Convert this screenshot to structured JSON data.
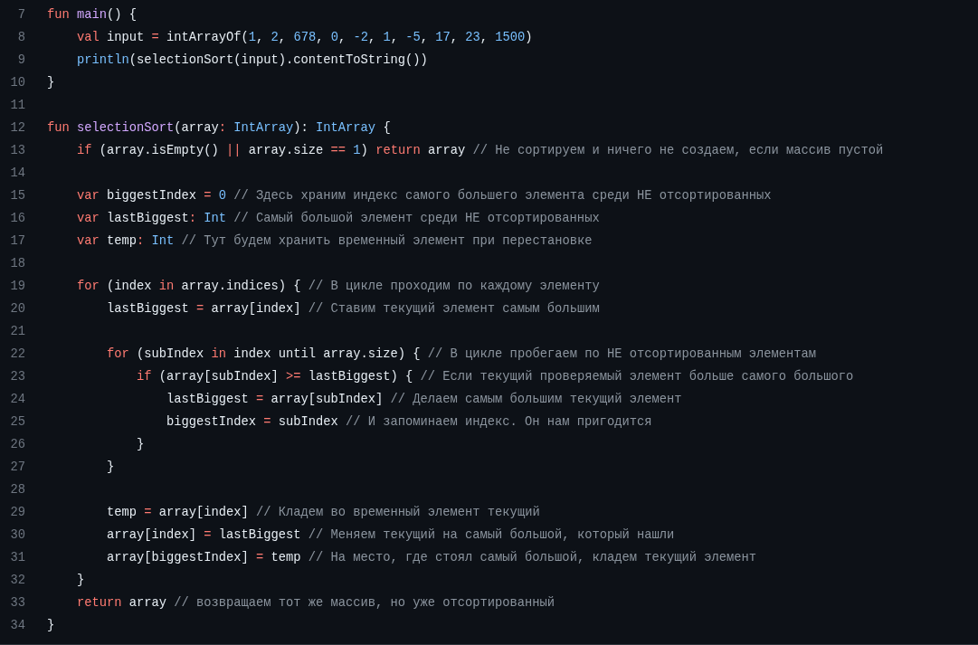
{
  "code_lines": [
    {
      "number": "7",
      "tokens": [
        {
          "kind": "kw",
          "text": "fun "
        },
        {
          "kind": "fn",
          "text": "main"
        },
        {
          "kind": "plain",
          "text": "() {"
        }
      ]
    },
    {
      "number": "8",
      "tokens": [
        {
          "kind": "kw",
          "text": "    val "
        },
        {
          "kind": "plain",
          "text": "input "
        },
        {
          "kind": "op",
          "text": "= "
        },
        {
          "kind": "plain",
          "text": "intArrayOf("
        },
        {
          "kind": "num",
          "text": "1"
        },
        {
          "kind": "plain",
          "text": ", "
        },
        {
          "kind": "num",
          "text": "2"
        },
        {
          "kind": "plain",
          "text": ", "
        },
        {
          "kind": "num",
          "text": "678"
        },
        {
          "kind": "plain",
          "text": ", "
        },
        {
          "kind": "num",
          "text": "0"
        },
        {
          "kind": "plain",
          "text": ", "
        },
        {
          "kind": "num",
          "text": "-2"
        },
        {
          "kind": "plain",
          "text": ", "
        },
        {
          "kind": "num",
          "text": "1"
        },
        {
          "kind": "plain",
          "text": ", "
        },
        {
          "kind": "num",
          "text": "-5"
        },
        {
          "kind": "plain",
          "text": ", "
        },
        {
          "kind": "num",
          "text": "17"
        },
        {
          "kind": "plain",
          "text": ", "
        },
        {
          "kind": "num",
          "text": "23"
        },
        {
          "kind": "plain",
          "text": ", "
        },
        {
          "kind": "num",
          "text": "1500"
        },
        {
          "kind": "plain",
          "text": ")"
        }
      ]
    },
    {
      "number": "9",
      "tokens": [
        {
          "kind": "type",
          "text": "    println"
        },
        {
          "kind": "plain",
          "text": "(selectionSort(input).contentToString())"
        }
      ]
    },
    {
      "number": "10",
      "tokens": [
        {
          "kind": "plain",
          "text": "}"
        }
      ]
    },
    {
      "number": "11"
    },
    {
      "number": "12",
      "tokens": [
        {
          "kind": "kw",
          "text": "fun "
        },
        {
          "kind": "fn",
          "text": "selectionSort"
        },
        {
          "kind": "plain",
          "text": "(array"
        },
        {
          "kind": "op",
          "text": ": "
        },
        {
          "kind": "type",
          "text": "IntArray"
        },
        {
          "kind": "plain",
          "text": "): "
        },
        {
          "kind": "type",
          "text": "IntArray"
        },
        {
          "kind": "plain",
          "text": " {"
        }
      ]
    },
    {
      "number": "13",
      "tokens": [
        {
          "kind": "kw",
          "text": "    if "
        },
        {
          "kind": "plain",
          "text": "(array.isEmpty() "
        },
        {
          "kind": "op",
          "text": "|| "
        },
        {
          "kind": "plain",
          "text": "array.size "
        },
        {
          "kind": "op",
          "text": "== "
        },
        {
          "kind": "num",
          "text": "1"
        },
        {
          "kind": "plain",
          "text": ") "
        },
        {
          "kind": "kw",
          "text": "return "
        },
        {
          "kind": "plain",
          "text": "array "
        },
        {
          "kind": "comment",
          "text": "// Не сортируем и ничего не создаем, если массив пустой"
        }
      ]
    },
    {
      "number": "14"
    },
    {
      "number": "15",
      "tokens": [
        {
          "kind": "kw",
          "text": "    var "
        },
        {
          "kind": "plain",
          "text": "biggestIndex "
        },
        {
          "kind": "op",
          "text": "= "
        },
        {
          "kind": "num",
          "text": "0 "
        },
        {
          "kind": "comment",
          "text": "// Здесь храним индекс самого большего элемента среди НЕ отсортированных"
        }
      ]
    },
    {
      "number": "16",
      "tokens": [
        {
          "kind": "kw",
          "text": "    var "
        },
        {
          "kind": "plain",
          "text": "lastBiggest"
        },
        {
          "kind": "op",
          "text": ": "
        },
        {
          "kind": "type",
          "text": "Int "
        },
        {
          "kind": "comment",
          "text": "// Самый большой элемент среди НЕ отсортированных"
        }
      ]
    },
    {
      "number": "17",
      "tokens": [
        {
          "kind": "kw",
          "text": "    var "
        },
        {
          "kind": "plain",
          "text": "temp"
        },
        {
          "kind": "op",
          "text": ": "
        },
        {
          "kind": "type",
          "text": "Int "
        },
        {
          "kind": "comment",
          "text": "// Тут будем хранить временный элемент при перестановке"
        }
      ]
    },
    {
      "number": "18"
    },
    {
      "number": "19",
      "tokens": [
        {
          "kind": "kw",
          "text": "    for "
        },
        {
          "kind": "plain",
          "text": "(index "
        },
        {
          "kind": "kw",
          "text": "in "
        },
        {
          "kind": "plain",
          "text": "array.indices) { "
        },
        {
          "kind": "comment",
          "text": "// В цикле проходим по каждому элементу"
        }
      ]
    },
    {
      "number": "20",
      "tokens": [
        {
          "kind": "plain",
          "text": "        lastBiggest "
        },
        {
          "kind": "op",
          "text": "= "
        },
        {
          "kind": "plain",
          "text": "array[index] "
        },
        {
          "kind": "comment",
          "text": "// Ставим текущий элемент самым большим"
        }
      ]
    },
    {
      "number": "21"
    },
    {
      "number": "22",
      "tokens": [
        {
          "kind": "kw",
          "text": "        for "
        },
        {
          "kind": "plain",
          "text": "(subIndex "
        },
        {
          "kind": "kw",
          "text": "in "
        },
        {
          "kind": "plain",
          "text": "index until array.size) { "
        },
        {
          "kind": "comment",
          "text": "// В цикле пробегаем по НЕ отсортированным элементам"
        }
      ]
    },
    {
      "number": "23",
      "tokens": [
        {
          "kind": "kw",
          "text": "            if "
        },
        {
          "kind": "plain",
          "text": "(array[subIndex] "
        },
        {
          "kind": "op",
          "text": ">= "
        },
        {
          "kind": "plain",
          "text": "lastBiggest) { "
        },
        {
          "kind": "comment",
          "text": "// Если текущий проверяемый элемент больше самого большого"
        }
      ]
    },
    {
      "number": "24",
      "tokens": [
        {
          "kind": "plain",
          "text": "                lastBiggest "
        },
        {
          "kind": "op",
          "text": "= "
        },
        {
          "kind": "plain",
          "text": "array[subIndex] "
        },
        {
          "kind": "comment",
          "text": "// Делаем самым большим текущий элемент"
        }
      ]
    },
    {
      "number": "25",
      "tokens": [
        {
          "kind": "plain",
          "text": "                biggestIndex "
        },
        {
          "kind": "op",
          "text": "= "
        },
        {
          "kind": "plain",
          "text": "subIndex "
        },
        {
          "kind": "comment",
          "text": "// И запоминаем индекс. Он нам пригодится"
        }
      ]
    },
    {
      "number": "26",
      "tokens": [
        {
          "kind": "plain",
          "text": "            }"
        }
      ]
    },
    {
      "number": "27",
      "tokens": [
        {
          "kind": "plain",
          "text": "        }"
        }
      ]
    },
    {
      "number": "28"
    },
    {
      "number": "29",
      "tokens": [
        {
          "kind": "plain",
          "text": "        temp "
        },
        {
          "kind": "op",
          "text": "= "
        },
        {
          "kind": "plain",
          "text": "array[index] "
        },
        {
          "kind": "comment",
          "text": "// Кладем во временный элемент текущий"
        }
      ]
    },
    {
      "number": "30",
      "tokens": [
        {
          "kind": "plain",
          "text": "        array[index] "
        },
        {
          "kind": "op",
          "text": "= "
        },
        {
          "kind": "plain",
          "text": "lastBiggest "
        },
        {
          "kind": "comment",
          "text": "// Меняем текущий на самый большой, который нашли"
        }
      ]
    },
    {
      "number": "31",
      "tokens": [
        {
          "kind": "plain",
          "text": "        array[biggestIndex] "
        },
        {
          "kind": "op",
          "text": "= "
        },
        {
          "kind": "plain",
          "text": "temp "
        },
        {
          "kind": "comment",
          "text": "// На место, где стоял самый большой, кладем текущий элемент"
        }
      ]
    },
    {
      "number": "32",
      "tokens": [
        {
          "kind": "plain",
          "text": "    }"
        }
      ]
    },
    {
      "number": "33",
      "tokens": [
        {
          "kind": "kw",
          "text": "    return "
        },
        {
          "kind": "plain",
          "text": "array "
        },
        {
          "kind": "comment",
          "text": "// возвращаем тот же массив, но уже отсортированный"
        }
      ]
    },
    {
      "number": "34",
      "tokens": [
        {
          "kind": "plain",
          "text": "}"
        }
      ]
    }
  ]
}
